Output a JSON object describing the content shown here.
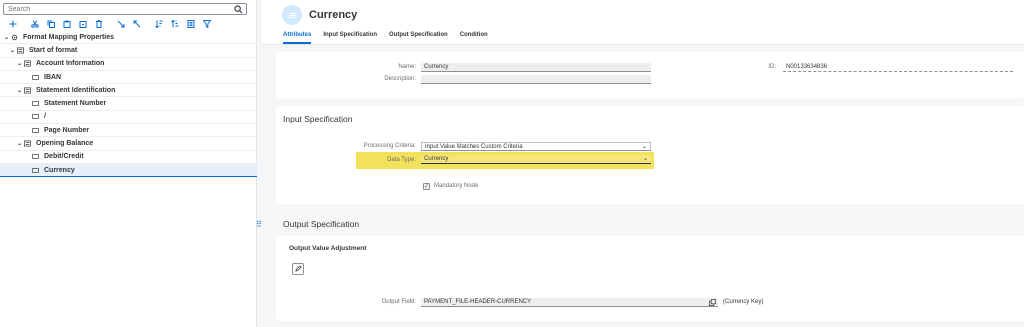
{
  "search": {
    "placeholder": "Search"
  },
  "tree": [
    {
      "label": "Format Mapping Properties",
      "level": 0,
      "icon": "gear-icon",
      "expanded": true
    },
    {
      "label": "Start of format",
      "level": 1,
      "icon": "structure-icon",
      "expanded": true
    },
    {
      "label": "Account Information",
      "level": 2,
      "icon": "list-icon",
      "expanded": true
    },
    {
      "label": "IBAN",
      "level": 3,
      "icon": "field-icon"
    },
    {
      "label": "Statement Identification",
      "level": 2,
      "icon": "list-icon",
      "expanded": true
    },
    {
      "label": "Statement Number",
      "level": 3,
      "icon": "field-icon"
    },
    {
      "label": "/",
      "level": 3,
      "icon": "field-icon"
    },
    {
      "label": "Page Number",
      "level": 3,
      "icon": "field-icon"
    },
    {
      "label": "Opening Balance",
      "level": 2,
      "icon": "list-icon",
      "expanded": true
    },
    {
      "label": "Debit/Credit",
      "level": 3,
      "icon": "field-icon"
    },
    {
      "label": "Currency",
      "level": 3,
      "icon": "field-icon",
      "selected": true
    }
  ],
  "header": {
    "title": "Currency",
    "tabs": [
      "Attributes",
      "Input Specification",
      "Output Specification",
      "Condition"
    ]
  },
  "attributes": {
    "name_label": "Name:",
    "name_value": "Currency",
    "description_label": "Description:",
    "description_value": "",
    "id_label": "ID:",
    "id_value": "N00133634836"
  },
  "input_spec": {
    "title": "Input Specification",
    "processing_label": "Processing Criteria:",
    "processing_value": "Input Value Matches Custom Criteria",
    "datatype_label": "Data Type:",
    "datatype_value": "Currency",
    "mandatory_label": "Mandatory Node"
  },
  "output_spec": {
    "title": "Output Specification",
    "adjustment_title": "Output Value Adjustment",
    "output_field_label": "Output Field:",
    "output_field_value": "PAYMENT_FILE-HEADER-CURRENCY",
    "output_field_desc": "(Currency Key)"
  },
  "colors": {
    "accent": "#0a6ed1",
    "highlight": "#f2e15b"
  }
}
